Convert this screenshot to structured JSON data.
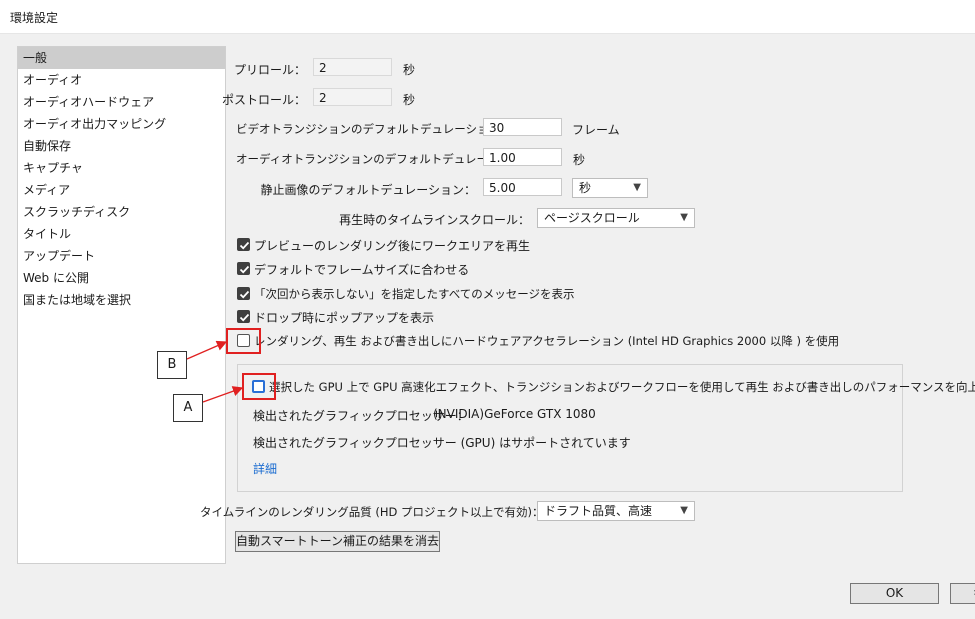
{
  "window": {
    "title": "環境設定"
  },
  "sidebar": {
    "items": [
      {
        "label": "一般"
      },
      {
        "label": "オーディオ"
      },
      {
        "label": "オーディオハードウェア"
      },
      {
        "label": "オーディオ出力マッピング"
      },
      {
        "label": "自動保存"
      },
      {
        "label": "キャプチャ"
      },
      {
        "label": "メディア"
      },
      {
        "label": "スクラッチディスク"
      },
      {
        "label": "タイトル"
      },
      {
        "label": "アップデート"
      },
      {
        "label": "Web に公開"
      },
      {
        "label": "国または地域を選択"
      }
    ]
  },
  "general": {
    "preroll": {
      "label": "プリロール：",
      "value": "2",
      "unit": "秒"
    },
    "postroll": {
      "label": "ポストロール：",
      "value": "2",
      "unit": "秒"
    },
    "video_transition": {
      "label": "ビデオトランジションのデフォルトデュレーション：",
      "value": "30",
      "unit": "フレーム"
    },
    "audio_transition": {
      "label": "オーディオトランジションのデフォルトデュレーション：",
      "value": "1.00",
      "unit": "秒"
    },
    "still_image": {
      "label": "静止画像のデフォルトデュレーション：",
      "value": "5.00",
      "unit_select": "秒"
    },
    "timeline_scroll": {
      "label": "再生時のタイムラインスクロール：",
      "value": "ページスクロール"
    },
    "checkboxes": [
      {
        "label": "プレビューのレンダリング後にワークエリアを再生",
        "checked": true
      },
      {
        "label": "デフォルトでフレームサイズに合わせる",
        "checked": true
      },
      {
        "label": "「次回から表示しない」を指定したすべてのメッセージを表示",
        "checked": true
      },
      {
        "label": "ドロップ時にポップアップを表示",
        "checked": true
      },
      {
        "label": "レンダリング、再生 および書き出しにハードウェアアクセラレーション (Intel HD Graphics 2000 以降 ) を使用",
        "checked": false
      }
    ],
    "gpu": {
      "checkbox_label": "選択した GPU 上で GPU 高速化エフェクト、トランジションおよびワークフローを使用して再生 および書き出しのパフォーマンスを向上",
      "checked": false,
      "detected_label": "検出されたグラフィックプロセッサー：",
      "detected_value": "(NVIDIA)GeForce GTX 1080",
      "support_text": "検出されたグラフィックプロセッサー (GPU) はサポートされています",
      "details_link": "詳細"
    },
    "render_quality": {
      "label": "タイムラインのレンダリング品質 (HD プロジェクト以上で有効)：",
      "value": "ドラフト品質、高速"
    },
    "clear_button": "自動スマートトーン補正の結果を消去"
  },
  "footer": {
    "ok": "OK",
    "cancel": "キ"
  },
  "annotations": {
    "a": "A",
    "b": "B",
    "highlight_color": "#e02020"
  }
}
